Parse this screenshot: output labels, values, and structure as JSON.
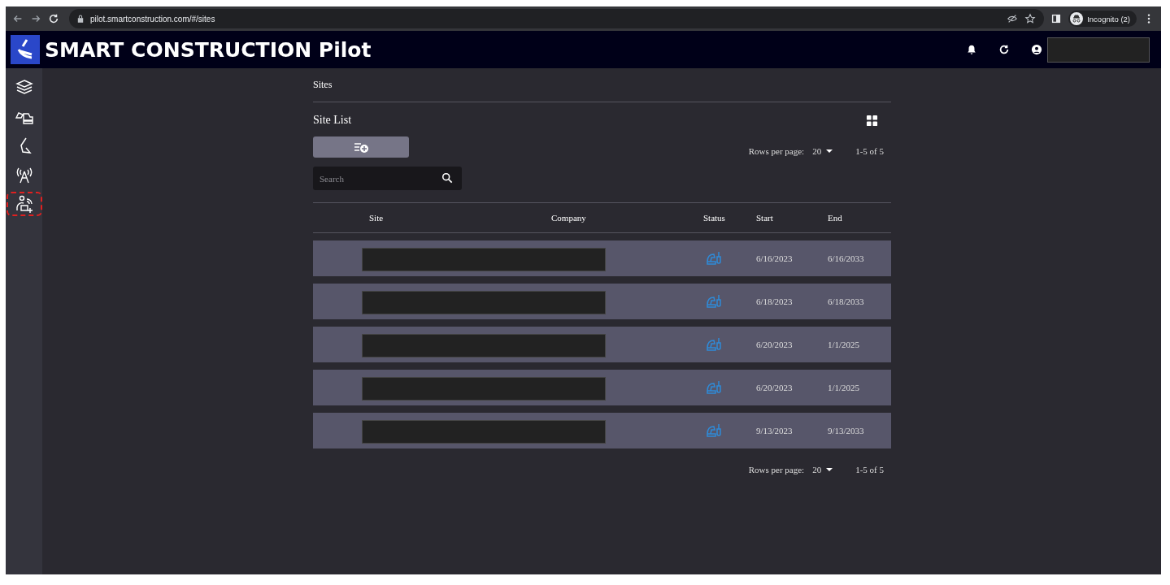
{
  "browser": {
    "url": "pilot.smartconstruction.com/#/sites",
    "profile_label": "Incognito (2)"
  },
  "header": {
    "title": "SMART CONSTRUCTION Pilot"
  },
  "sidebar": {
    "items": [
      {
        "kind": "layers",
        "highlighted": false
      },
      {
        "kind": "excavator",
        "highlighted": false
      },
      {
        "kind": "bucket",
        "highlighted": false
      },
      {
        "kind": "antenna",
        "highlighted": false
      },
      {
        "kind": "user-device",
        "highlighted": true
      }
    ]
  },
  "breadcrumb": "Sites",
  "heading": "Site List",
  "search": {
    "placeholder": "Search"
  },
  "pagination_top": {
    "label": "Rows per page:",
    "value": "20",
    "range": "1-5 of 5"
  },
  "table": {
    "columns": [
      "Site",
      "Company",
      "Status",
      "Start",
      "End"
    ],
    "rows": [
      {
        "start": "6/16/2023",
        "end": "6/16/2033"
      },
      {
        "start": "6/18/2023",
        "end": "6/18/2033"
      },
      {
        "start": "6/20/2023",
        "end": "1/1/2025"
      },
      {
        "start": "6/20/2023",
        "end": "1/1/2025"
      },
      {
        "start": "9/13/2023",
        "end": "9/13/2033"
      }
    ]
  },
  "pagination_bottom": {
    "label": "Rows per page:",
    "value": "20",
    "range": "1-5 of 5"
  }
}
